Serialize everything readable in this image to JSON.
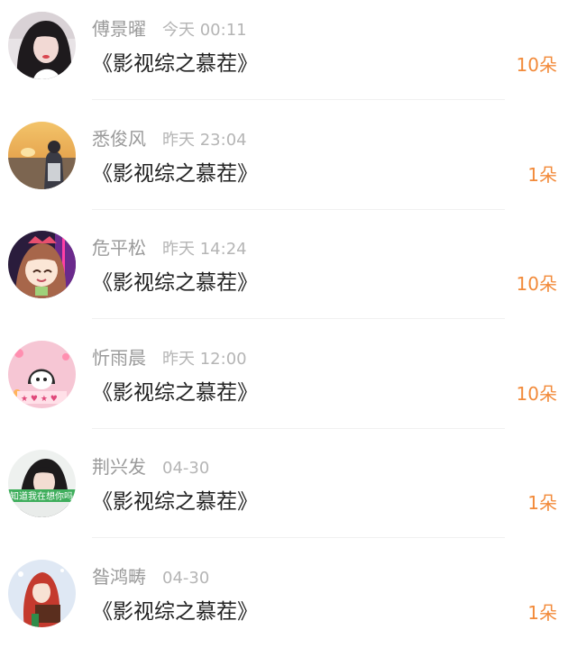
{
  "accent_color": "#f28a3a",
  "rows": [
    {
      "name": "傅景曜",
      "time": "今天 00:11",
      "title": "《影视综之慕茬》",
      "gift": "10朵",
      "avatar_icon": "user-avatar-girl-dark-hair"
    },
    {
      "name": "悉俊风",
      "time": "昨天 23:04",
      "title": "《影视综之慕茬》",
      "gift": "1朵",
      "avatar_icon": "user-avatar-sunset-lake"
    },
    {
      "name": "危平松",
      "time": "昨天 14:24",
      "title": "《影视综之慕茬》",
      "gift": "10朵",
      "avatar_icon": "user-avatar-anime-girl"
    },
    {
      "name": "忻雨晨",
      "time": "昨天 12:00",
      "title": "《影视综之慕茬》",
      "gift": "10朵",
      "avatar_icon": "user-avatar-cartoon-pink"
    },
    {
      "name": "荆兴发",
      "time": "04-30",
      "title": "《影视综之慕茬》",
      "gift": "1朵",
      "avatar_icon": "user-avatar-girl-green-banner",
      "avatar_banner_text": "知道我在想你吗"
    },
    {
      "name": "昝鸿畴",
      "time": "04-30",
      "title": "《影视综之慕茬》",
      "gift": "1朵",
      "avatar_icon": "user-avatar-anime-red-hair"
    }
  ]
}
